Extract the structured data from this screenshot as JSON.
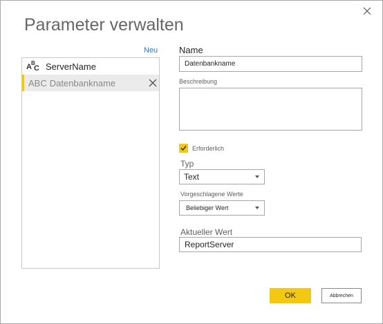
{
  "dialog": {
    "title": "Parameter verwalten",
    "close_icon": "close-icon"
  },
  "list": {
    "new_label": "Neu",
    "items": [
      {
        "type_icon": "abc-text-type-icon",
        "label": "ServerName",
        "selected": false
      },
      {
        "type_text": "ABC",
        "label": "Datenbankname",
        "selected": true,
        "remove_icon": "close-icon"
      }
    ]
  },
  "form": {
    "name_label": "Name",
    "name_value": "Datenbankname",
    "description_label": "Beschreibung",
    "description_value": "",
    "required_label": "Erforderlich",
    "required_checked": true,
    "type_label": "Typ",
    "type_value": "Text",
    "suggested_label": "Vorgeschlagene Werte",
    "suggested_value": "Beliebiger Wert",
    "current_label": "Aktueller Wert",
    "current_value": "ReportServer"
  },
  "buttons": {
    "ok_label": "OK",
    "cancel_label": "Abbrechen"
  },
  "colors": {
    "accent": "#f2c811",
    "link": "#2b79c2",
    "selected_row": "#ebebeb",
    "border": "#a6a6a6"
  }
}
